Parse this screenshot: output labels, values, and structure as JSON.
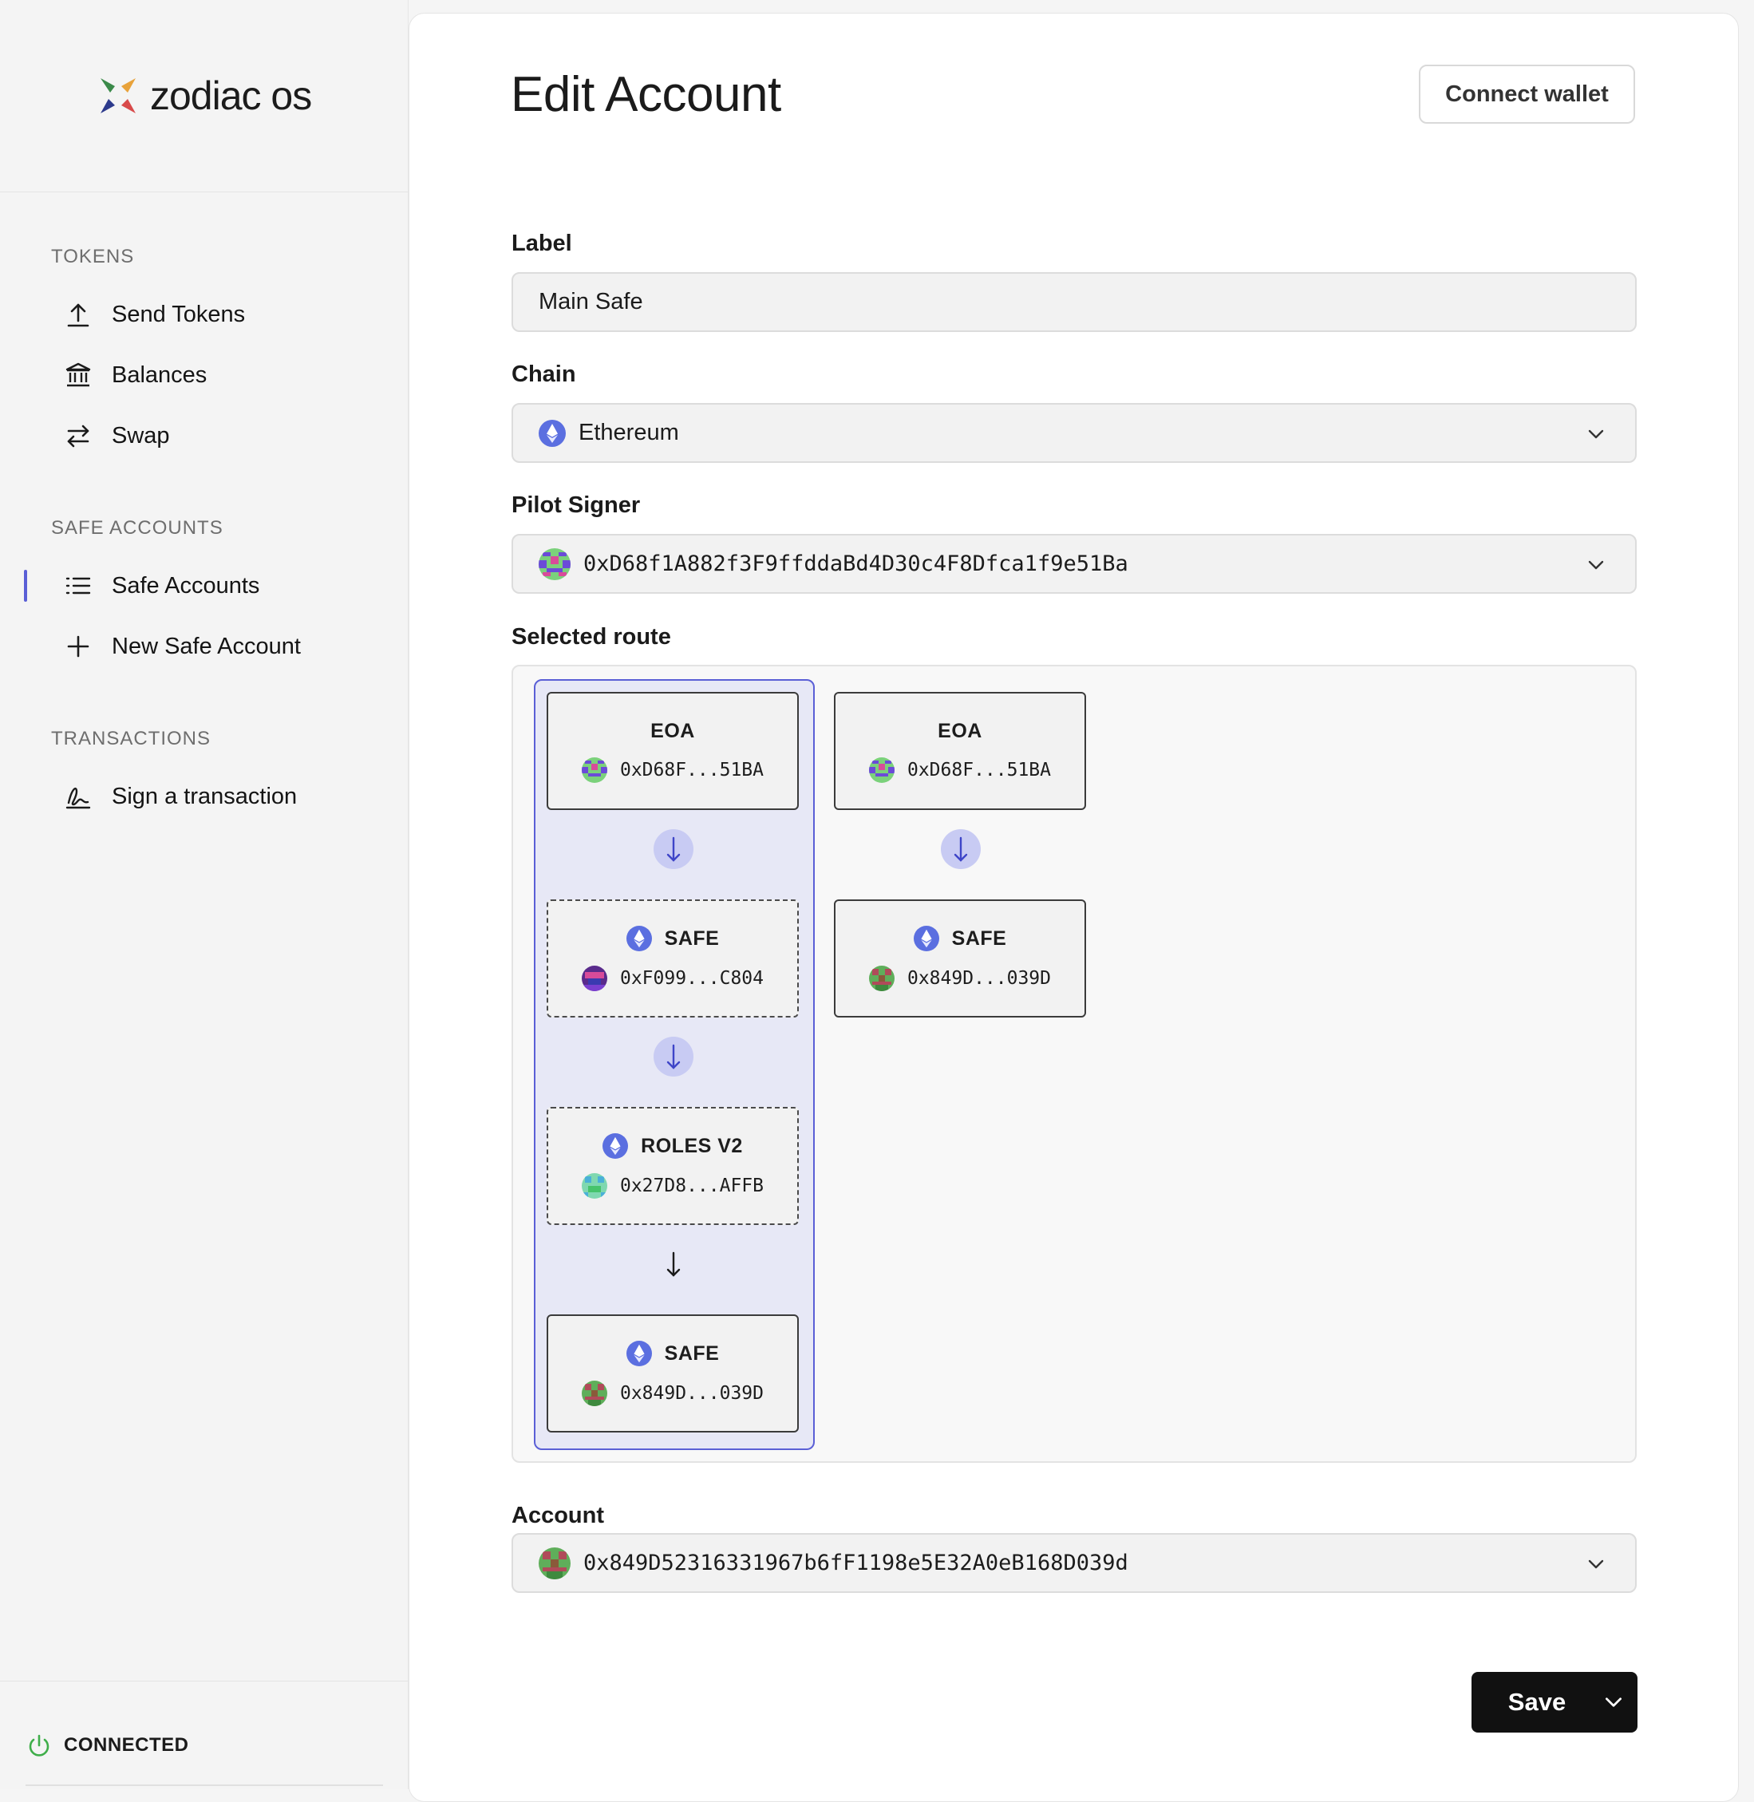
{
  "app": {
    "brand": "zodiac os"
  },
  "sidebar": {
    "sections": [
      {
        "title": "TOKENS",
        "items": [
          {
            "label": "Send Tokens",
            "icon": "upload-icon"
          },
          {
            "label": "Balances",
            "icon": "bank-icon"
          },
          {
            "label": "Swap",
            "icon": "swap-icon"
          }
        ]
      },
      {
        "title": "SAFE ACCOUNTS",
        "items": [
          {
            "label": "Safe Accounts",
            "icon": "list-icon",
            "active": true
          },
          {
            "label": "New Safe Account",
            "icon": "plus-icon"
          }
        ]
      },
      {
        "title": "TRANSACTIONS",
        "items": [
          {
            "label": "Sign a transaction",
            "icon": "signature-icon"
          }
        ]
      }
    ],
    "status": "CONNECTED",
    "accent_color": "#5a5fd6",
    "status_color": "#3fae4a"
  },
  "header": {
    "title": "Edit Account",
    "connect_label": "Connect wallet"
  },
  "form": {
    "label_field": {
      "label": "Label",
      "value": "Main Safe"
    },
    "chain_field": {
      "label": "Chain",
      "value": "Ethereum"
    },
    "signer_field": {
      "label": "Pilot Signer",
      "value": "0xD68f1A882f3F9ffddaBd4D30c4F8Dfca1f9e51Ba"
    },
    "route_label": "Selected route",
    "account_field": {
      "label": "Account",
      "value": "0x849D52316331967b6fF1198e5E32A0eB168D039d"
    }
  },
  "routes": [
    {
      "selected": true,
      "nodes": [
        {
          "type": "EOA",
          "address": "0xD68F...51BA"
        },
        {
          "type": "SAFE",
          "address": "0xF099...C804"
        },
        {
          "type": "ROLES V2",
          "address": "0x27D8...AFFB"
        },
        {
          "type": "SAFE",
          "address": "0x849D...039D"
        }
      ]
    },
    {
      "selected": false,
      "nodes": [
        {
          "type": "EOA",
          "address": "0xD68F...51BA"
        },
        {
          "type": "SAFE",
          "address": "0x849D...039D"
        }
      ]
    }
  ],
  "footer": {
    "save_label": "Save"
  }
}
